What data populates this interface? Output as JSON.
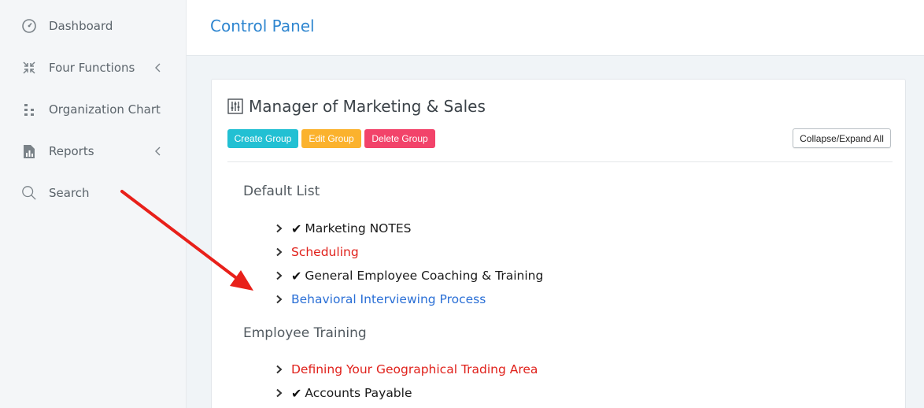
{
  "sidebar": {
    "items": [
      {
        "label": "Dashboard",
        "icon": "dashboard-gauge-icon",
        "has_chevron": false
      },
      {
        "label": "Four Functions",
        "icon": "compress-arrows-icon",
        "has_chevron": true
      },
      {
        "label": "Organization Chart",
        "icon": "org-chart-icon",
        "has_chevron": false
      },
      {
        "label": "Reports",
        "icon": "report-file-icon",
        "has_chevron": true
      },
      {
        "label": "Search",
        "icon": "search-icon",
        "has_chevron": false
      }
    ]
  },
  "header": {
    "title": "Control Panel"
  },
  "card": {
    "title": "Manager of Marketing & Sales",
    "title_icon": "sliders-icon",
    "buttons": {
      "create": "Create Group",
      "edit": "Edit Group",
      "delete": "Delete Group",
      "collapse": "Collapse/Expand All"
    },
    "groups": [
      {
        "heading": "Default List",
        "items": [
          {
            "check": "✔",
            "label": "Marketing NOTES",
            "color": "#1a1a1a"
          },
          {
            "check": "",
            "label": "Scheduling",
            "color": "#e0211b"
          },
          {
            "check": "✔",
            "label": "General Employee Coaching & Training",
            "color": "#1a1a1a"
          },
          {
            "check": "",
            "label": "Behavioral Interviewing Process",
            "color": "#2a6fd6"
          }
        ]
      },
      {
        "heading": "Employee Training",
        "items": [
          {
            "check": "",
            "label": "Defining Your Geographical Trading Area",
            "color": "#e0211b"
          },
          {
            "check": "✔",
            "label": "Accounts Payable",
            "color": "#1a1a1a"
          }
        ]
      }
    ]
  },
  "colors": {
    "accent": "#2f86d0",
    "create": "#22c0d3",
    "edit": "#fbb22d",
    "delete": "#f2436a",
    "arrow": "#e8201a"
  }
}
